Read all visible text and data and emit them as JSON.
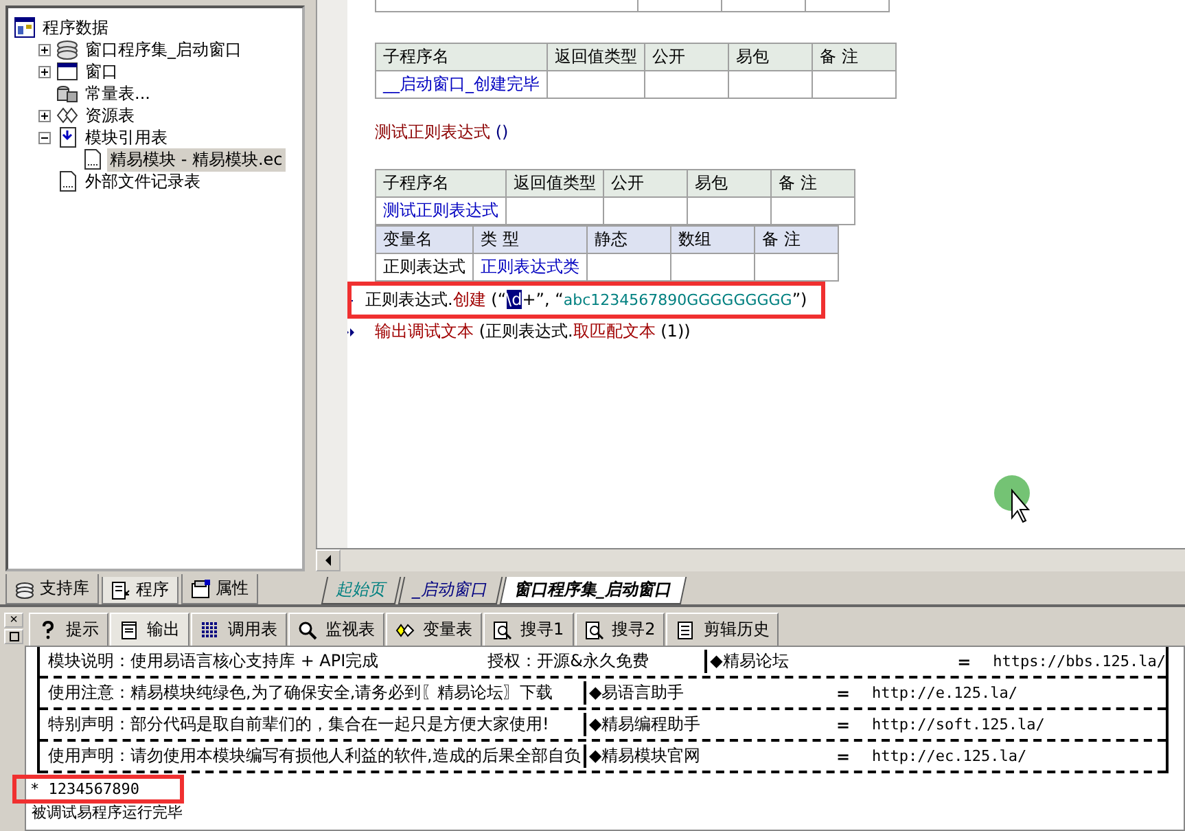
{
  "tree": [
    {
      "label": "程序数据",
      "kind": "program",
      "selected": false,
      "children": [
        {
          "label": "窗口程序集_启动窗口",
          "kind": "class",
          "expanded": false,
          "selected": false
        },
        {
          "label": "窗口",
          "kind": "window",
          "expanded": false,
          "selected": false
        },
        {
          "label": "常量表...",
          "kind": "constants",
          "selected": false
        },
        {
          "label": "资源表",
          "kind": "resources",
          "expanded": false,
          "selected": false
        },
        {
          "label": "模块引用表",
          "kind": "modules",
          "expanded": true,
          "selected": false,
          "children": [
            {
              "label": "精易模块 - 精易模块.ec",
              "kind": "file",
              "selected": true
            }
          ]
        },
        {
          "label": "外部文件记录表",
          "kind": "file",
          "selected": false
        }
      ]
    }
  ],
  "left_tabs": [
    {
      "label": "支持库",
      "kind": "library",
      "selected": false
    },
    {
      "label": "程序",
      "kind": "program",
      "selected": true
    },
    {
      "label": "属性",
      "kind": "properties",
      "selected": false
    }
  ],
  "editor": {
    "sub1": {
      "columns": [
        "子程序名",
        "返回值类型",
        "公开",
        "易包",
        "备 注"
      ],
      "row": [
        "__启动窗口_创建完毕"
      ]
    },
    "heading": {
      "name": "测试正则表达式",
      "parens": "()"
    },
    "sub2": {
      "columns": [
        "子程序名",
        "返回值类型",
        "公开",
        "易包",
        "备 注"
      ],
      "row": [
        "测试正则表达式"
      ]
    },
    "vars": {
      "columns": [
        "变量名",
        "类 型",
        "静态",
        "数组",
        "备 注"
      ],
      "row": [
        "正则表达式",
        "正则表达式类"
      ]
    },
    "lines": [
      {
        "kind": "current",
        "segments": [
          {
            "text": "正则表达式.",
            "kind": "plain"
          },
          {
            "text": "创建",
            "kind": "command"
          },
          {
            "text": " (“",
            "kind": "plain"
          },
          {
            "text": "\\d",
            "kind": "selected"
          },
          {
            "text": "+”, “",
            "kind": "plain"
          },
          {
            "text": "abc1234567890GGGGGGGGG",
            "kind": "string"
          },
          {
            "text": "”)",
            "kind": "plain"
          }
        ]
      },
      {
        "kind": "next",
        "segments": [
          {
            "text": "输出调试文本",
            "kind": "command"
          },
          {
            "text": " (正则表达式.",
            "kind": "plain"
          },
          {
            "text": "取匹配文本",
            "kind": "command"
          },
          {
            "text": " (1))",
            "kind": "plain"
          }
        ]
      }
    ]
  },
  "file_tabs": [
    {
      "label": "起始页",
      "color": "#008080",
      "selected": false
    },
    {
      "label": "_启动窗口",
      "color": "#000080",
      "selected": false
    },
    {
      "label": "窗口程序集_启动窗口",
      "color": "#000000",
      "selected": true
    }
  ],
  "bottom_tabs": [
    {
      "label": "提示",
      "kind": "hint",
      "selected": false
    },
    {
      "label": "输出",
      "kind": "output",
      "selected": true
    },
    {
      "label": "调用表",
      "kind": "calls",
      "selected": false
    },
    {
      "label": "监视表",
      "kind": "watch",
      "selected": false
    },
    {
      "label": "变量表",
      "kind": "variables",
      "selected": false
    },
    {
      "label": "搜寻1",
      "kind": "search",
      "selected": false
    },
    {
      "label": "搜寻2",
      "kind": "search",
      "selected": false
    },
    {
      "label": "剪辑历史",
      "kind": "clipboard",
      "selected": false
    }
  ],
  "close_glyph": "×",
  "output": {
    "rows": [
      {
        "text": "模块说明：使用易语言核心支持库 + API完成",
        "extra": "授权：开源&永久免费",
        "site": "◆精易论坛",
        "eq": "=",
        "url": "https://bbs.125.la/"
      },
      {
        "text": "使用注意：精易模块纯绿色,为了确保安全,请务必到〖精易论坛〗下载",
        "site": "◆易语言助手",
        "eq": "=",
        "url": "http://e.125.la/"
      },
      {
        "text": "特别声明：部分代码是取自前辈们的，集合在一起只是方便大家使用!",
        "site": "◆精易编程助手",
        "eq": "=",
        "url": "http://soft.125.la/"
      },
      {
        "text": "使用声明：请勿使用本模块编写有损他人利益的软件,造成的后果全部自负",
        "site": "◆精易模块官网",
        "eq": "=",
        "url": "http://ec.125.la/"
      }
    ],
    "lines": [
      "* 1234567890",
      "被调试易程序运行完毕"
    ]
  }
}
